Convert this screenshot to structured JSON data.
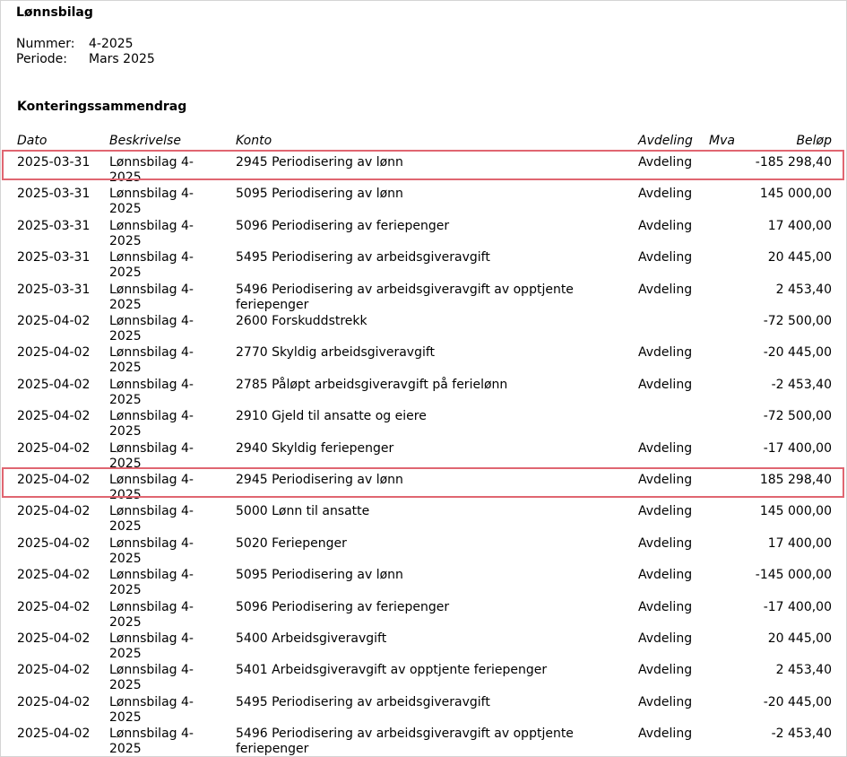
{
  "document": {
    "title": "Lønnsbilag",
    "meta": [
      {
        "label": "Nummer:",
        "value": "4-2025"
      },
      {
        "label": "Periode:",
        "value": "Mars 2025"
      }
    ],
    "section_title": "Konteringssammendrag"
  },
  "table": {
    "headers": {
      "date": "Dato",
      "description": "Beskrivelse",
      "account": "Konto",
      "department": "Avdeling",
      "vat": "Mva",
      "amount": "Beløp"
    },
    "rows": [
      {
        "date": "2025-03-31",
        "description": "Lønnsbilag 4-2025",
        "account": "2945 Periodisering av lønn",
        "department": "Avdeling",
        "amount": "-185 298,40",
        "highlighted": true
      },
      {
        "date": "2025-03-31",
        "description": "Lønnsbilag 4-2025",
        "account": "5095 Periodisering av lønn",
        "department": "Avdeling",
        "amount": "145 000,00"
      },
      {
        "date": "2025-03-31",
        "description": "Lønnsbilag 4-2025",
        "account": "5096 Periodisering av feriepenger",
        "department": "Avdeling",
        "amount": "17 400,00"
      },
      {
        "date": "2025-03-31",
        "description": "Lønnsbilag 4-2025",
        "account": "5495 Periodisering av arbeidsgiveravgift",
        "department": "Avdeling",
        "amount": "20 445,00"
      },
      {
        "date": "2025-03-31",
        "description": "Lønnsbilag 4-2025",
        "account": "5496 Periodisering av arbeidsgiveravgift av opptjente feriepenger",
        "department": "Avdeling",
        "amount": "2 453,40"
      },
      {
        "date": "2025-04-02",
        "description": "Lønnsbilag 4-2025",
        "account": "2600 Forskuddstrekk",
        "department": "",
        "amount": "-72 500,00"
      },
      {
        "date": "2025-04-02",
        "description": "Lønnsbilag 4-2025",
        "account": "2770 Skyldig arbeidsgiveravgift",
        "department": "Avdeling",
        "amount": "-20 445,00"
      },
      {
        "date": "2025-04-02",
        "description": "Lønnsbilag 4-2025",
        "account": "2785 Påløpt arbeidsgiveravgift på ferielønn",
        "department": "Avdeling",
        "amount": "-2 453,40"
      },
      {
        "date": "2025-04-02",
        "description": "Lønnsbilag 4-2025",
        "account": "2910 Gjeld til ansatte og eiere",
        "department": "",
        "amount": "-72 500,00"
      },
      {
        "date": "2025-04-02",
        "description": "Lønnsbilag 4-2025",
        "account": "2940 Skyldig feriepenger",
        "department": "Avdeling",
        "amount": "-17 400,00"
      },
      {
        "date": "2025-04-02",
        "description": "Lønnsbilag 4-2025",
        "account": "2945 Periodisering av lønn",
        "department": "Avdeling",
        "amount": "185 298,40",
        "highlighted": true
      },
      {
        "date": "2025-04-02",
        "description": "Lønnsbilag 4-2025",
        "account": "5000 Lønn til ansatte",
        "department": "Avdeling",
        "amount": "145 000,00"
      },
      {
        "date": "2025-04-02",
        "description": "Lønnsbilag 4-2025",
        "account": "5020 Feriepenger",
        "department": "Avdeling",
        "amount": "17 400,00"
      },
      {
        "date": "2025-04-02",
        "description": "Lønnsbilag 4-2025",
        "account": "5095 Periodisering av lønn",
        "department": "Avdeling",
        "amount": "-145 000,00"
      },
      {
        "date": "2025-04-02",
        "description": "Lønnsbilag 4-2025",
        "account": "5096 Periodisering av feriepenger",
        "department": "Avdeling",
        "amount": "-17 400,00"
      },
      {
        "date": "2025-04-02",
        "description": "Lønnsbilag 4-2025",
        "account": "5400 Arbeidsgiveravgift",
        "department": "Avdeling",
        "amount": "20 445,00"
      },
      {
        "date": "2025-04-02",
        "description": "Lønnsbilag 4-2025",
        "account": "5401 Arbeidsgiveravgift av opptjente feriepenger",
        "department": "Avdeling",
        "amount": "2 453,40"
      },
      {
        "date": "2025-04-02",
        "description": "Lønnsbilag 4-2025",
        "account": "5495 Periodisering av arbeidsgiveravgift",
        "department": "Avdeling",
        "amount": "-20 445,00"
      },
      {
        "date": "2025-04-02",
        "description": "Lønnsbilag 4-2025",
        "account": "5496 Periodisering av arbeidsgiveravgift av opptjente feriepenger",
        "department": "Avdeling",
        "amount": "-2 453,40"
      }
    ]
  },
  "colors": {
    "highlight_border": "#e06671"
  }
}
